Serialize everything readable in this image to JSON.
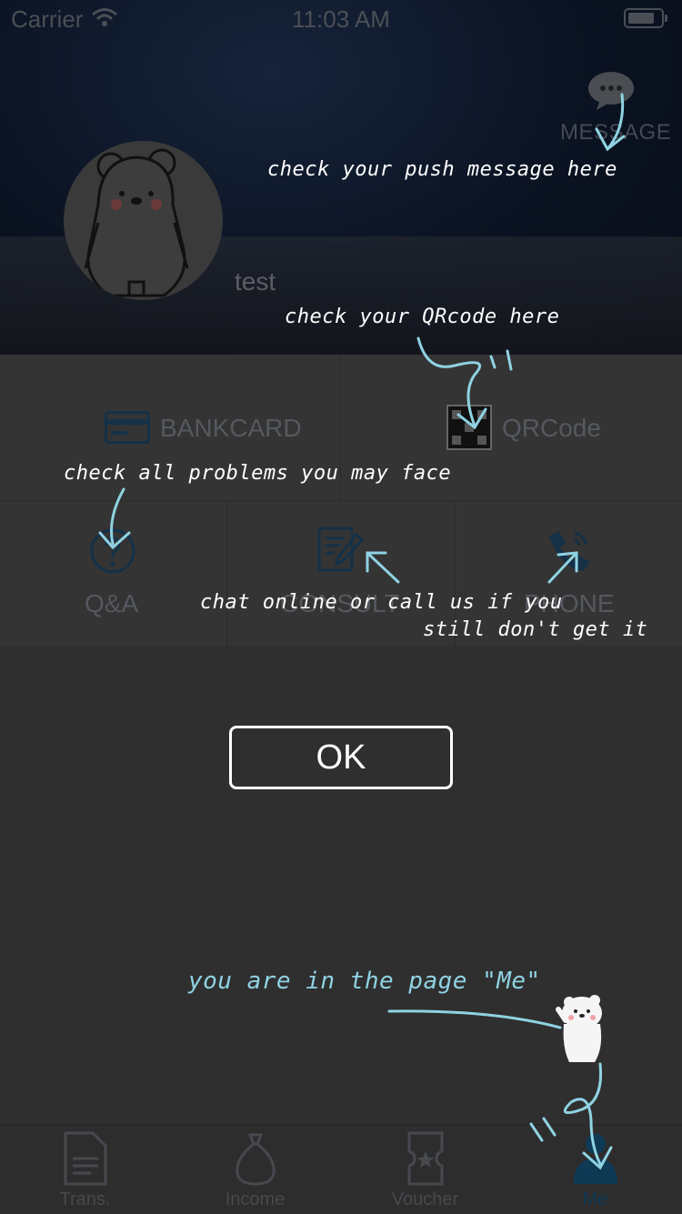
{
  "status_bar": {
    "carrier": "Carrier",
    "time": "11:03 AM"
  },
  "header": {
    "message_label": "MESSAGE",
    "username": "test"
  },
  "grid": {
    "top": [
      {
        "label": "BANKCARD",
        "icon": "bank-card-icon"
      },
      {
        "label": "QRCode",
        "icon": "qr-code-icon"
      }
    ],
    "bottom": [
      {
        "label": "Q&A",
        "icon": "question-icon"
      },
      {
        "label": "CONSULT",
        "icon": "consult-icon"
      },
      {
        "label": "PHONE",
        "icon": "phone-icon"
      }
    ]
  },
  "tabs": [
    {
      "label": "Trans.",
      "icon": "document-icon",
      "active": false
    },
    {
      "label": "Income",
      "icon": "money-bag-icon",
      "active": false
    },
    {
      "label": "Voucher",
      "icon": "ticket-icon",
      "active": false
    },
    {
      "label": "Me",
      "icon": "person-icon",
      "active": true
    }
  ],
  "overlay": {
    "push_note": "check your push message here",
    "qr_note": "check your QRcode here",
    "problems_note": "check all problems you may face",
    "chat_note": "chat online or call us if you",
    "chat_note_2": "still don't get it",
    "me_note": "you are in the page \"Me\"",
    "ok_label": "OK"
  },
  "colors": {
    "overlay_text": "#ffffff",
    "accent": "#8fd3e3",
    "active_tab": "#0e3a55"
  }
}
